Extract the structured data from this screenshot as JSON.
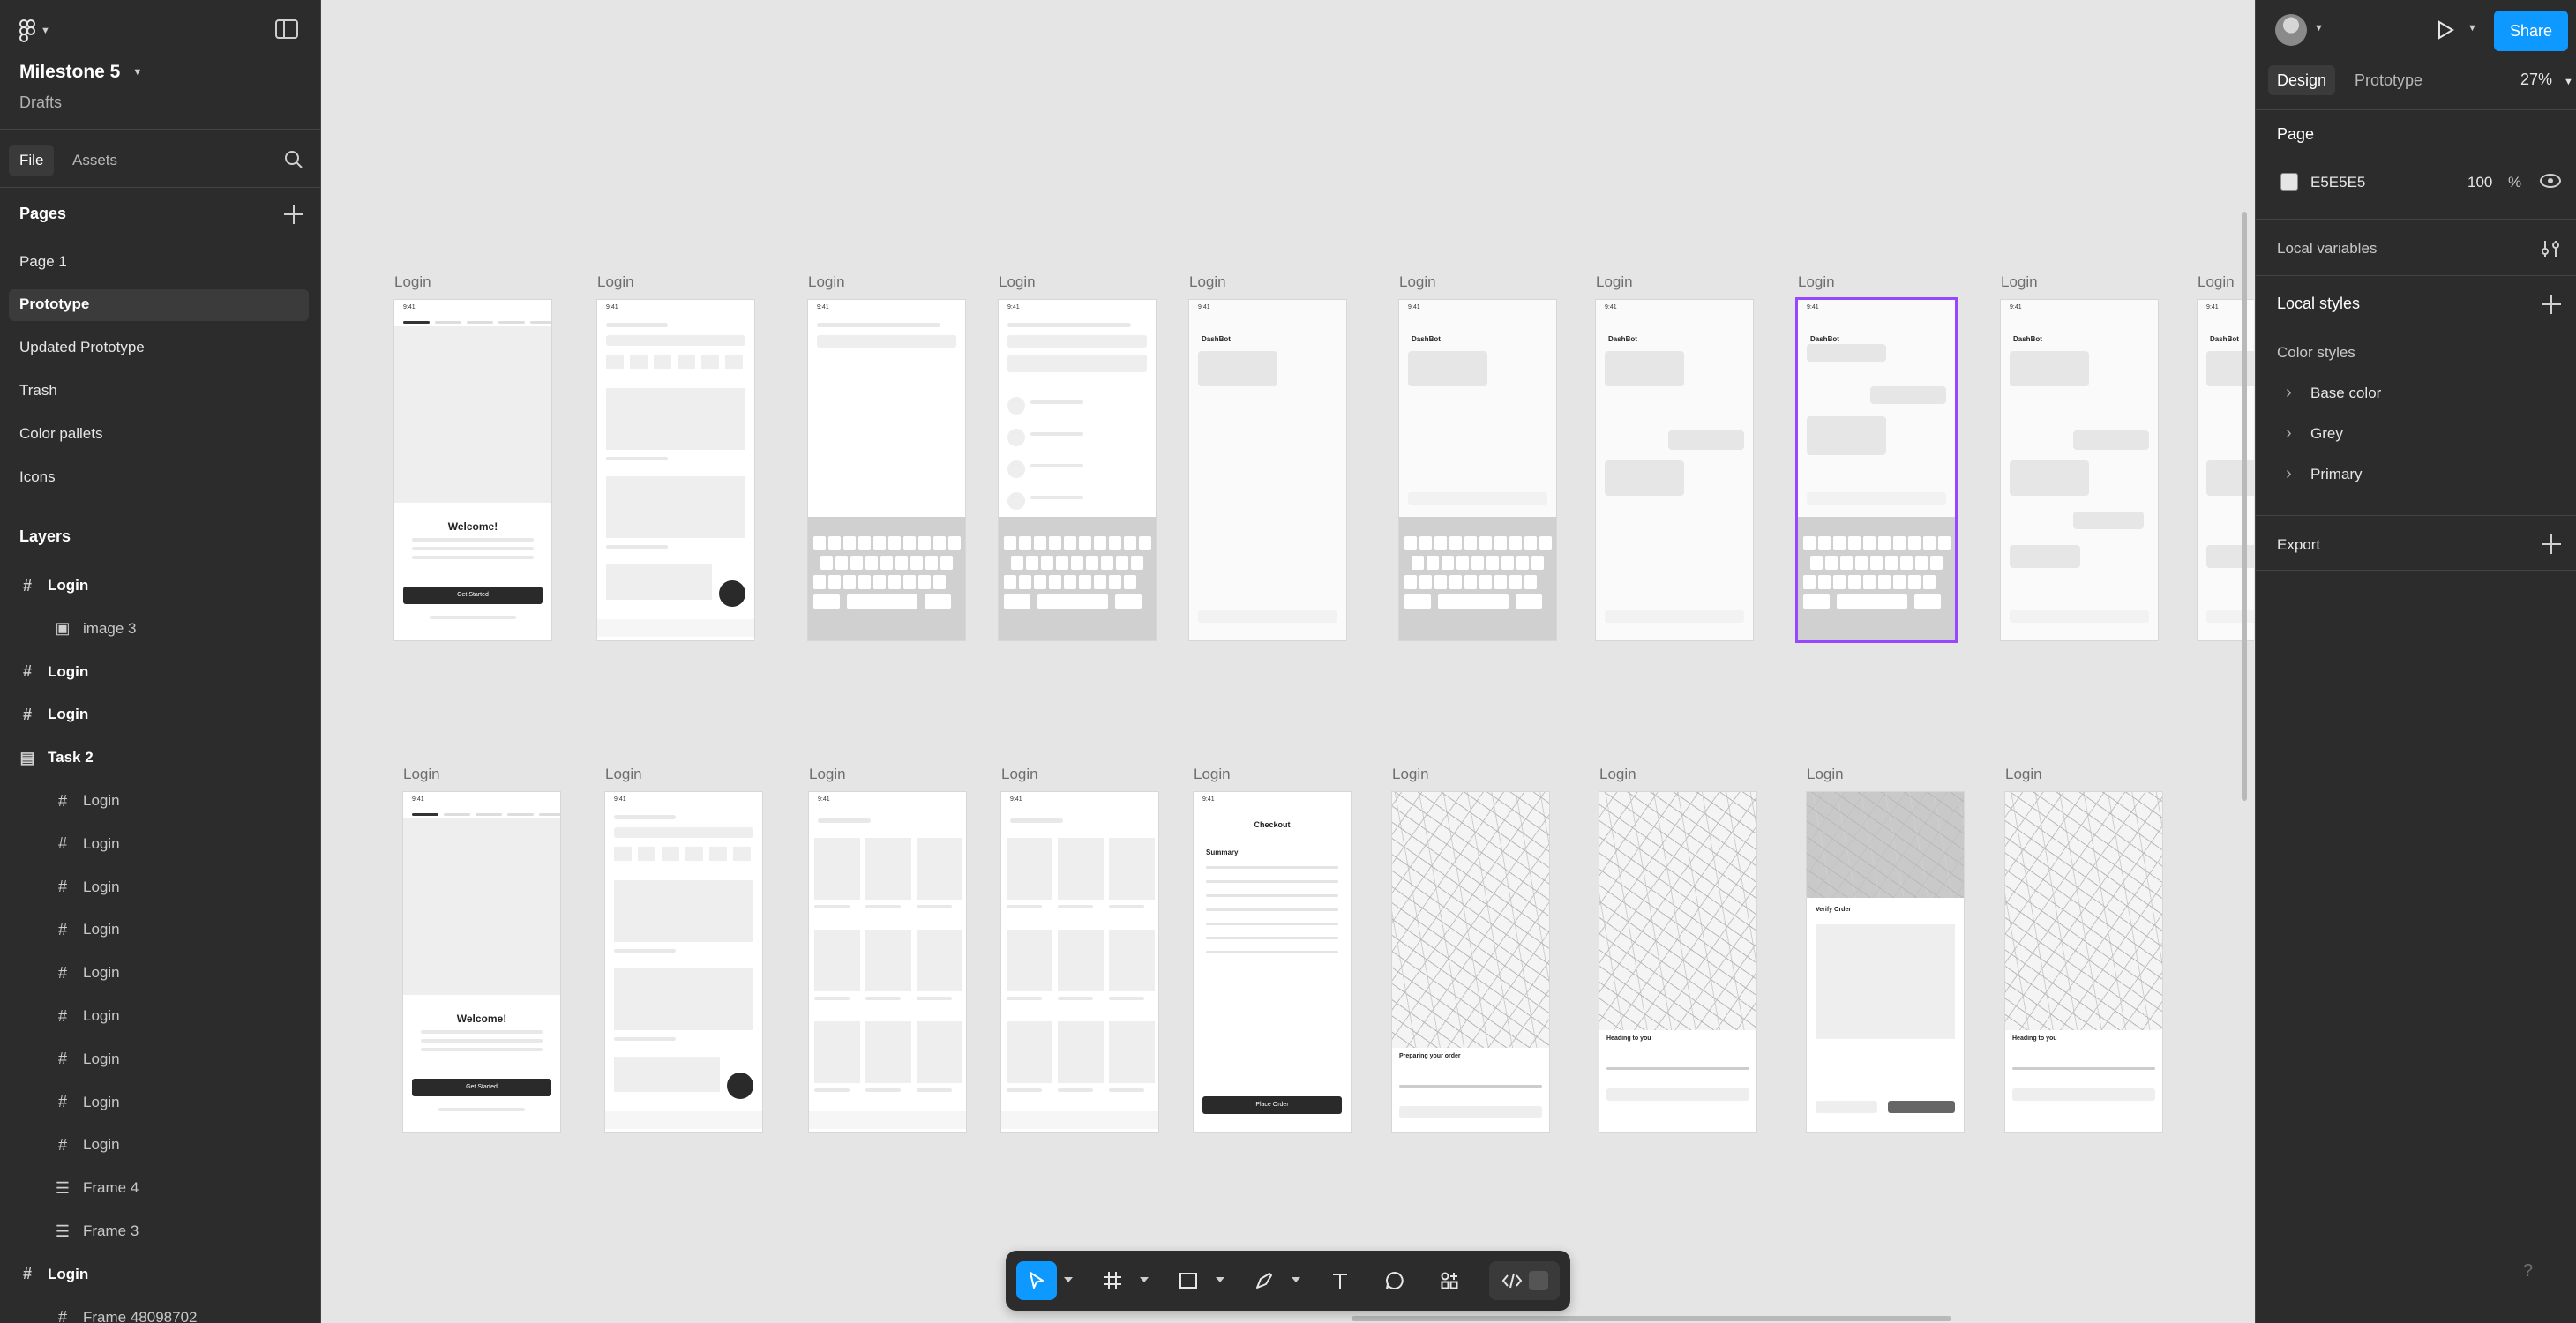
{
  "file": {
    "name": "Milestone 5",
    "location": "Drafts"
  },
  "left_tabs": {
    "file": "File",
    "assets": "Assets"
  },
  "pages": {
    "title": "Pages",
    "items": [
      "Page 1",
      "Prototype",
      "Updated Prototype",
      "Trash",
      "Color pallets",
      "Icons"
    ],
    "active": "Prototype"
  },
  "layers": {
    "title": "Layers",
    "items": [
      {
        "label": "Login",
        "icon": "frame-icon",
        "indent": 0,
        "bold": true
      },
      {
        "label": "image 3",
        "icon": "image-icon",
        "indent": 1,
        "bold": false
      },
      {
        "label": "Login",
        "icon": "frame-icon",
        "indent": 0,
        "bold": true
      },
      {
        "label": "Login",
        "icon": "frame-icon",
        "indent": 0,
        "bold": true
      },
      {
        "label": "Task 2",
        "icon": "section-icon",
        "indent": 0,
        "bold": true
      },
      {
        "label": "Login",
        "icon": "frame-icon",
        "indent": 1,
        "bold": false
      },
      {
        "label": "Login",
        "icon": "frame-icon",
        "indent": 1,
        "bold": false
      },
      {
        "label": "Login",
        "icon": "frame-icon",
        "indent": 1,
        "bold": false
      },
      {
        "label": "Login",
        "icon": "frame-icon",
        "indent": 1,
        "bold": false
      },
      {
        "label": "Login",
        "icon": "frame-icon",
        "indent": 1,
        "bold": false
      },
      {
        "label": "Login",
        "icon": "frame-icon",
        "indent": 1,
        "bold": false
      },
      {
        "label": "Login",
        "icon": "frame-icon",
        "indent": 1,
        "bold": false
      },
      {
        "label": "Login",
        "icon": "frame-icon",
        "indent": 1,
        "bold": false
      },
      {
        "label": "Login",
        "icon": "frame-icon",
        "indent": 1,
        "bold": false
      },
      {
        "label": "Frame 4",
        "icon": "component-frame-icon",
        "indent": 1,
        "bold": false
      },
      {
        "label": "Frame 3",
        "icon": "component-frame-icon",
        "indent": 1,
        "bold": false
      },
      {
        "label": "Login",
        "icon": "frame-icon",
        "indent": 0,
        "bold": true
      },
      {
        "label": "Frame 48098702",
        "icon": "frame-icon",
        "indent": 1,
        "bold": false
      }
    ]
  },
  "right": {
    "share": "Share",
    "tabs": {
      "design": "Design",
      "prototype": "Prototype"
    },
    "zoom": "27%",
    "page_title": "Page",
    "page_color": "E5E5E5",
    "page_opacity": "100",
    "percent": "%",
    "local_variables": "Local variables",
    "local_styles": "Local styles",
    "color_styles": "Color styles",
    "styles": [
      "Base color",
      "Grey",
      "Primary"
    ],
    "export": "Export"
  },
  "canvas": {
    "frame_label": "Login",
    "welcome": "Welcome!",
    "get_started": "Get Started",
    "dashbot": "DashBot",
    "checkout": "Checkout",
    "summary": "Summary",
    "verify_order": "Verify Order",
    "preparing": "Preparing your order",
    "heading": "Heading to you",
    "place_order": "Place Order",
    "time": "9:41"
  },
  "toolbar": {
    "tools": [
      "move-tool-icon",
      "frame-tool-icon",
      "shape-tool-icon",
      "pen-tool-icon",
      "text-tool-icon",
      "comment-tool-icon",
      "actions-tool-icon",
      "dev-mode-icon"
    ]
  },
  "help": "?"
}
